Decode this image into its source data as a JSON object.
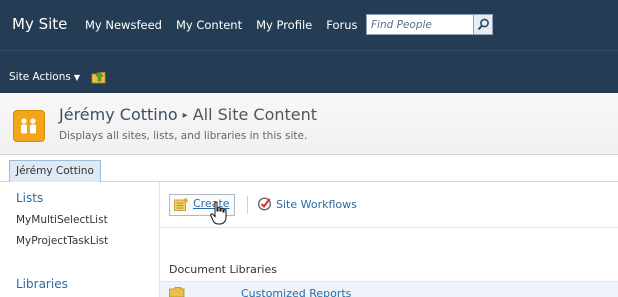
{
  "header": {
    "site_title": "My Site",
    "nav": [
      {
        "label": "My Newsfeed"
      },
      {
        "label": "My Content"
      },
      {
        "label": "My Profile"
      },
      {
        "label": "Forus"
      }
    ],
    "search": {
      "placeholder": "Find People",
      "value": ""
    },
    "site_actions": {
      "label": "Site Actions",
      "caret": "▼"
    }
  },
  "title_area": {
    "site_name": "Jérémy Cottino",
    "separator": "▸",
    "page_name": "All Site Content",
    "description": "Displays all sites, lists, and libraries in this site."
  },
  "tabs": [
    {
      "label": "Jérémy Cottino",
      "selected": true
    }
  ],
  "quick_launch": {
    "lists_heading": "Lists",
    "lists": [
      {
        "label": "MyMultiSelectList"
      },
      {
        "label": "MyProjectTaskList"
      }
    ],
    "libraries_heading": "Libraries"
  },
  "toolbar": {
    "create_label": "Create",
    "workflows_label": "Site Workflows"
  },
  "content": {
    "section_heading": "Document Libraries",
    "libraries": [
      {
        "label": "Customized Reports"
      }
    ]
  },
  "colors": {
    "topbar": "#243d55",
    "link": "#2a6aa5",
    "logo": "#f3a61b"
  },
  "icons": {
    "search": "magnifier-icon",
    "navigate_up": "folder-up-icon",
    "site_logo": "people-icon",
    "create": "create-icon",
    "workflows": "workflow-check-icon",
    "cursor": "hand-pointer-icon",
    "folder": "folder-icon"
  }
}
